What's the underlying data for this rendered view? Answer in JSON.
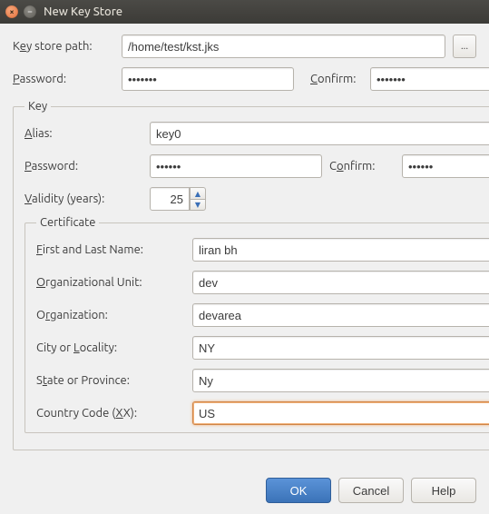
{
  "window": {
    "title": "New Key Store"
  },
  "top": {
    "path_label_pre": "K",
    "path_label_u": "e",
    "path_label_post": "y store path:",
    "path_value": "/home/test/kst.jks",
    "password_label_u": "P",
    "password_label_post": "assword:",
    "password_value": "•••••••",
    "confirm_label_u": "C",
    "confirm_label_post": "onfirm:",
    "confirm_value": "•••••••"
  },
  "key": {
    "legend": "Key",
    "alias_label_u": "A",
    "alias_label_post": "lias:",
    "alias_value": "key0",
    "password_label_u": "P",
    "password_label_post": "assword:",
    "password_value": "••••••",
    "confirm_label_pre": "C",
    "confirm_label_u": "o",
    "confirm_label_post": "nfirm:",
    "confirm_value": "••••••",
    "validity_label_u": "V",
    "validity_label_post": "alidity (years):",
    "validity_value": "25"
  },
  "cert": {
    "legend": "Certificate",
    "first_u": "F",
    "first_post": "irst and Last Name:",
    "first_val": "liran bh",
    "ou_u": "O",
    "ou_post": "rganizational Unit:",
    "ou_val": "dev",
    "org_pre": "O",
    "org_u": "r",
    "org_post": "ganization:",
    "org_val": "devarea",
    "city_pre": "City or ",
    "city_u": "L",
    "city_post": "ocality:",
    "city_val": "NY",
    "state_pre": "S",
    "state_u": "t",
    "state_post": "ate or Province:",
    "state_val": "Ny",
    "cc_pre": "Country Code (",
    "cc_u": "X",
    "cc_post": "X):",
    "cc_val": "US"
  },
  "buttons": {
    "ok": "OK",
    "cancel": "Cancel",
    "help": "Help"
  },
  "browse_glyph": "..."
}
